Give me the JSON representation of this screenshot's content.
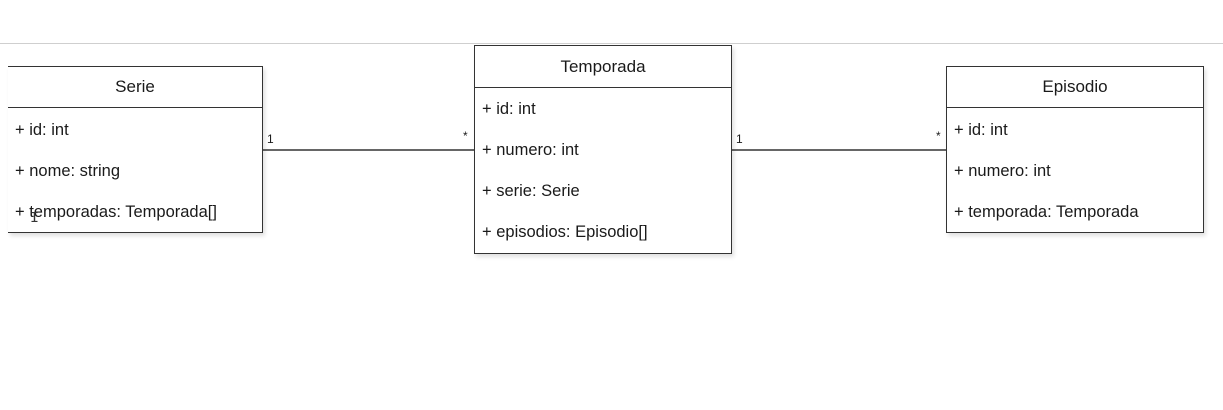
{
  "diagram": {
    "classes": [
      {
        "name": "Serie",
        "attributes": [
          "+ id: int",
          "+ nome: string",
          "+ temporadas: Temporada[]"
        ]
      },
      {
        "name": "Temporada",
        "attributes": [
          "+ id: int",
          "+ numero: int",
          "+ serie: Serie",
          "+ episodios: Episodio[]"
        ]
      },
      {
        "name": "Episodio",
        "attributes": [
          "+ id: int",
          "+ numero: int",
          "+ temporada: Temporada"
        ]
      }
    ],
    "associations": [
      {
        "from": "Serie",
        "to": "Temporada",
        "from_multiplicity": "1",
        "to_multiplicity": "*"
      },
      {
        "from": "Temporada",
        "to": "Episodio",
        "from_multiplicity": "1",
        "to_multiplicity": "*"
      }
    ]
  }
}
